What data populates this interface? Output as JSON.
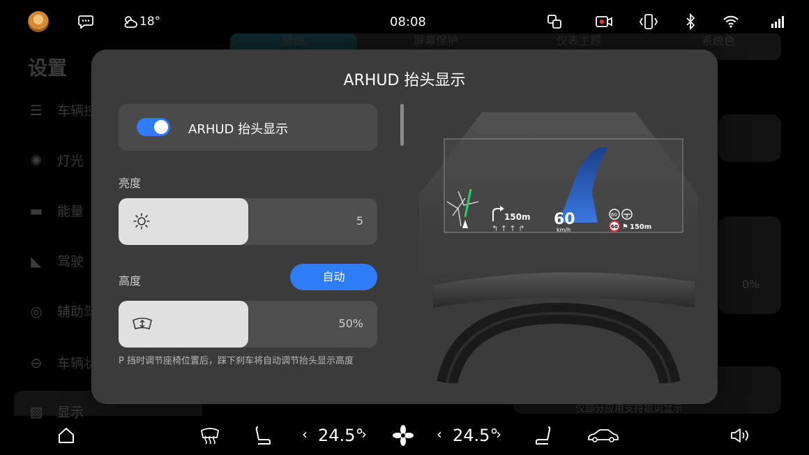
{
  "status_bar": {
    "weather_temp": "18°",
    "time": "08:08",
    "icons": [
      "avatar",
      "message-icon",
      "weather-icon",
      "screen-mirror-icon",
      "record-icon",
      "vibrate-icon",
      "bluetooth-icon",
      "wifi-icon",
      "signal-icon"
    ]
  },
  "background_page": {
    "title": "设置",
    "menu": [
      {
        "label": "车辆控",
        "icon": "toggle-icon"
      },
      {
        "label": "灯光",
        "icon": "light-icon"
      },
      {
        "label": "能量",
        "icon": "battery-icon"
      },
      {
        "label": "驾驶",
        "icon": "car-icon"
      },
      {
        "label": "辅助驾",
        "icon": "steering-icon"
      },
      {
        "label": "车辆状",
        "icon": "status-icon"
      },
      {
        "label": "显示",
        "icon": "display-icon"
      }
    ],
    "tabs": [
      "壁纸",
      "屏幕保护",
      "仪表主题",
      "系统色"
    ],
    "percent_value": "0%",
    "bottom_text": "仪部分应用支持歌词显示"
  },
  "dialog": {
    "title": "ARHUD 抬头显示",
    "toggle": {
      "label": "ARHUD 抬头显示",
      "on": true
    },
    "brightness": {
      "label": "亮度",
      "value": "5",
      "fill_fraction": 0.5
    },
    "height": {
      "label": "高度",
      "auto_label": "自动",
      "value": "50%",
      "fill_fraction": 0.5
    },
    "note": "P 挡时调节座椅位置后，踩下刹车将自动调节抬头显示高度"
  },
  "hud_preview": {
    "turn_distance": "150m",
    "speed": "60",
    "speed_unit": "km/h",
    "speed_limit": "60",
    "limit_distance": "150m"
  },
  "bottom_bar": {
    "driver_temp": "24.5°",
    "passenger_temp": "24.5°",
    "prev_symbol": "‹",
    "next_symbol": "›"
  },
  "colors": {
    "accent": "#2f7cf6",
    "dialog_bg": "#3b3b3b",
    "card_bg": "#4a4a4a"
  }
}
